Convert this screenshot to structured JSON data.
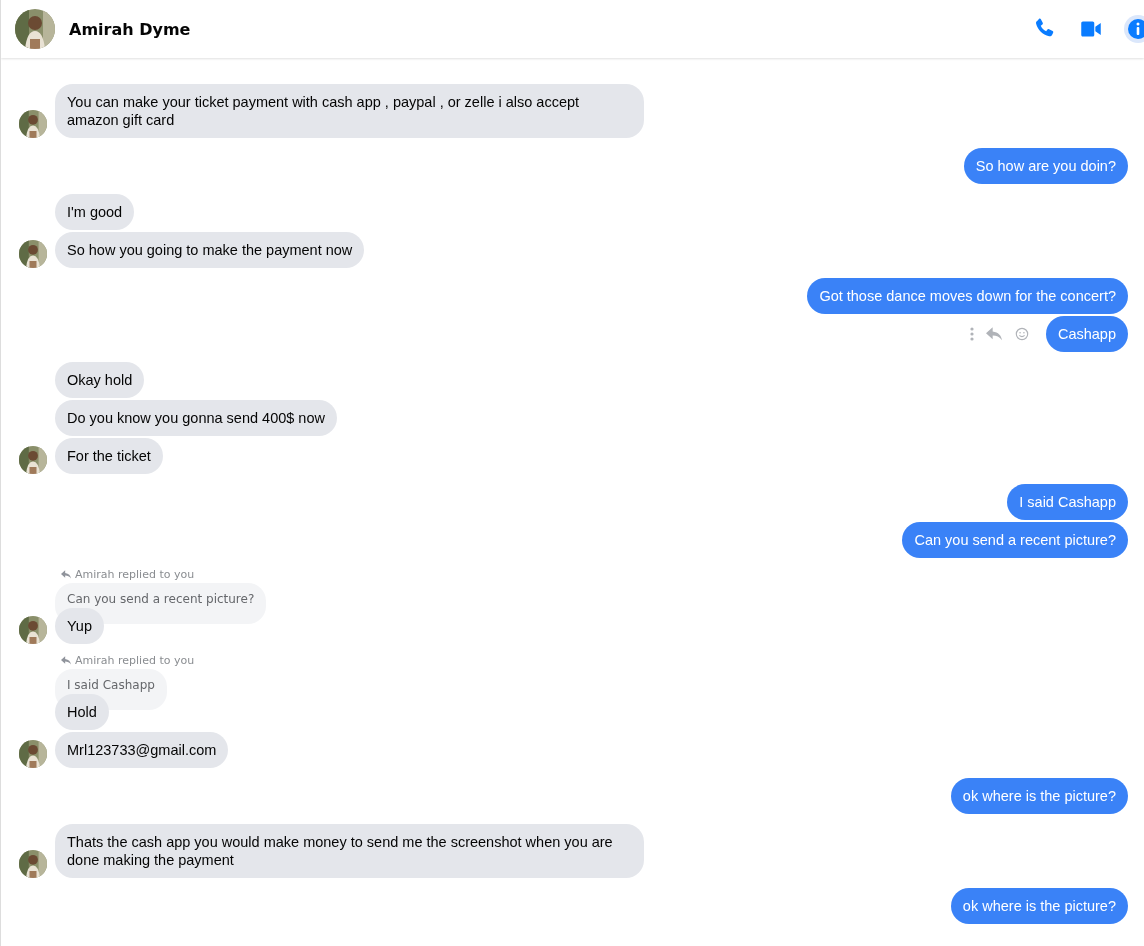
{
  "header": {
    "name": "Amirah Dyme"
  },
  "groups": [
    {
      "kind": "incoming",
      "messages": [
        {
          "text": "You can make your ticket payment with cash app , paypal , or zelle i also accept amazon gift card"
        }
      ]
    },
    {
      "kind": "outgoing",
      "messages": [
        {
          "text": "So how are you doin?"
        }
      ]
    },
    {
      "kind": "incoming",
      "messages": [
        {
          "text": "I'm good"
        },
        {
          "text": "So how you going to make the payment now"
        }
      ]
    },
    {
      "kind": "outgoing",
      "messages": [
        {
          "text": "Got those dance moves down for the concert?"
        },
        {
          "text": "Cashapp",
          "actions": true
        }
      ]
    },
    {
      "kind": "incoming",
      "messages": [
        {
          "text": "Okay hold"
        },
        {
          "text": "Do you know you gonna send 400$ now"
        },
        {
          "text": "For the ticket"
        }
      ]
    },
    {
      "kind": "outgoing",
      "messages": [
        {
          "text": "I said Cashapp"
        },
        {
          "text": "Can you send a recent picture?"
        }
      ]
    },
    {
      "kind": "incoming",
      "reply_label": "Amirah replied to you",
      "quoted": "Can you send a recent picture?",
      "messages": [
        {
          "text": "Yup"
        }
      ]
    },
    {
      "kind": "incoming",
      "reply_label": "Amirah replied to you",
      "quoted": "I said Cashapp",
      "messages": [
        {
          "text": "Hold"
        },
        {
          "text": "Mrl123733@gmail.com"
        }
      ]
    },
    {
      "kind": "outgoing",
      "messages": [
        {
          "text": "ok where is the picture?"
        }
      ]
    },
    {
      "kind": "incoming",
      "messages": [
        {
          "text": "Thats the cash app you would make money to send me the screenshot when you are done making the payment"
        }
      ]
    },
    {
      "kind": "outgoing",
      "messages": [
        {
          "text": "ok where is the picture?"
        }
      ]
    }
  ]
}
